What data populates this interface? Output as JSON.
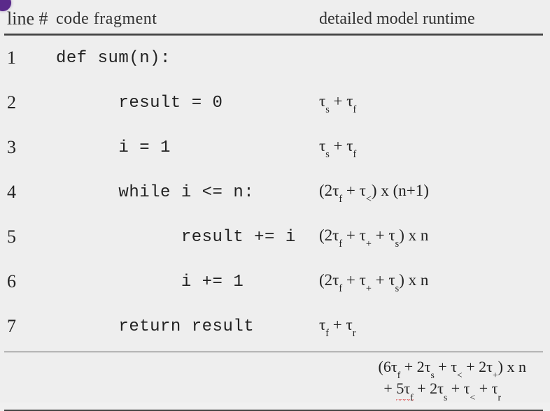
{
  "header": {
    "line": "line #",
    "code": "code fragment",
    "runtime": "detailed model runtime"
  },
  "rows": [
    {
      "n": "1",
      "indent": 0,
      "code": "def sum(n):",
      "runtime_html": ""
    },
    {
      "n": "2",
      "indent": 2,
      "code": "result = 0",
      "runtime_html": "τ<sub>s</sub> + τ<sub>f</sub>"
    },
    {
      "n": "3",
      "indent": 2,
      "code": "i = 1",
      "runtime_html": "τ<sub>s</sub> + τ<sub>f</sub>"
    },
    {
      "n": "4",
      "indent": 2,
      "code": "while i <= n:",
      "runtime_html": "(2τ<sub>f</sub> + τ<sub>&lt;</sub>) x  (n+1)"
    },
    {
      "n": "5",
      "indent": 4,
      "code": "result += i",
      "runtime_html": "(2τ<sub>f</sub> + τ<sub>+</sub> + τ<sub>s</sub>) x n"
    },
    {
      "n": "6",
      "indent": 4,
      "code": "i += 1",
      "runtime_html": "(2τ<sub>f</sub> + τ<sub>+</sub> + τ<sub>s</sub>) x n"
    },
    {
      "n": "7",
      "indent": 2,
      "code": "return result",
      "runtime_html": "τ<sub>f</sub> + τ<sub>r</sub>"
    }
  ],
  "total": {
    "line1_html": "(6τ<sub>f</sub> +  2τ<sub>s</sub> + τ<sub>&lt;</sub> +  2τ<sub>+</sub>)  x  n",
    "line2_html": "+  <span class=\"squiggle\">5τ<sub>f</sub></span> +  2τ<sub>s</sub> + τ<sub>&lt;</sub> +  τ<sub>r</sub>"
  },
  "chart_data": {
    "type": "table",
    "columns": [
      "line #",
      "code fragment",
      "detailed model runtime"
    ],
    "rows": [
      [
        "1",
        "def sum(n):",
        ""
      ],
      [
        "2",
        "    result = 0",
        "τ_s + τ_f"
      ],
      [
        "3",
        "    i = 1",
        "τ_s + τ_f"
      ],
      [
        "4",
        "    while i <= n:",
        "(2τ_f + τ_<) x (n+1)"
      ],
      [
        "5",
        "        result += i",
        "(2τ_f + τ_+ + τ_s) x n"
      ],
      [
        "6",
        "        i += 1",
        "(2τ_f + τ_+ + τ_s) x n"
      ],
      [
        "7",
        "    return result",
        "τ_f + τ_r"
      ]
    ],
    "total": "(6τ_f + 2τ_s + τ_< + 2τ_+) x n + 5τ_f + 2τ_s + τ_< + τ_r"
  }
}
